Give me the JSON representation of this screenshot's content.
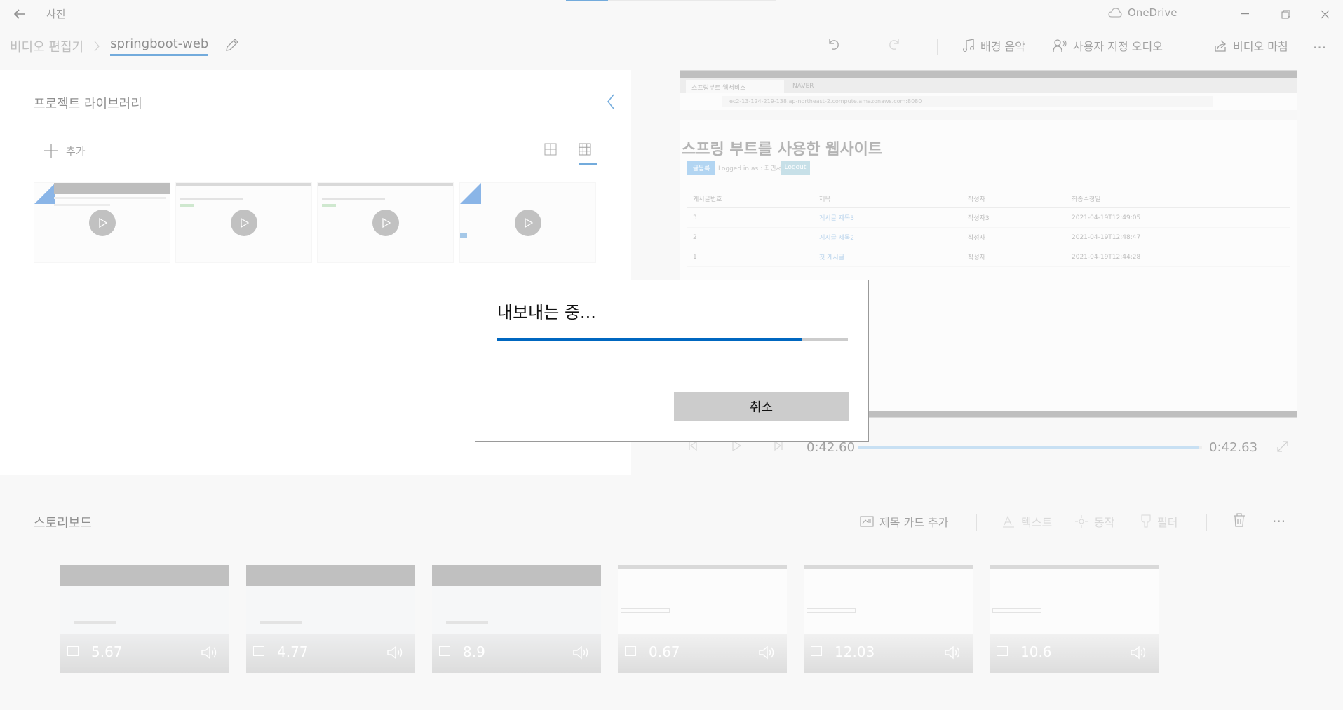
{
  "app": {
    "title": "사진",
    "cloud_label": "OneDrive"
  },
  "colors": {
    "accent": "#0067c0",
    "bg": "#f2f2f2"
  },
  "breadcrumb": {
    "parent": "비디오 편집기",
    "project": "springboot-web"
  },
  "toolbar": {
    "music_label": "배경 음악",
    "custom_audio_label": "사용자 지정 오디오",
    "finish_label": "비디오 마침"
  },
  "library": {
    "title": "프로젝트 라이브러리",
    "add_label": "추가"
  },
  "preview": {
    "site_title": "스프링 부트를 사용한 웹사이트",
    "tab1": "스프링부트 웹서비스",
    "tab2": "NAVER",
    "url": "ec2-13-124-219-138.ap-northeast-2.compute.amazonaws.com:8080",
    "btn_write": "글등록",
    "logged_in": "Logged in as : 최민서",
    "btn_logout": "Logout",
    "headers": [
      "게시글번호",
      "제목",
      "작성자",
      "최종수정일"
    ],
    "rows": [
      [
        "3",
        "게시글 제목3",
        "작성자3",
        "2021-04-19T12:49:05"
      ],
      [
        "2",
        "게시글 제목2",
        "작성자",
        "2021-04-19T12:48:47"
      ],
      [
        "1",
        "첫 게시글",
        "작성자",
        "2021-04-19T12:44:28"
      ]
    ]
  },
  "playback": {
    "current": "0:42.60",
    "total": "0:42.63",
    "progress": 0.99
  },
  "storyboard": {
    "title": "스토리보드",
    "add_title_card": "제목 카드 추가",
    "text": "텍스트",
    "motion": "동작",
    "filter": "필터",
    "clips": [
      {
        "duration": "5.67"
      },
      {
        "duration": "4.77"
      },
      {
        "duration": "8.9"
      },
      {
        "duration": "0.67"
      },
      {
        "duration": "12.03"
      },
      {
        "duration": "10.6"
      }
    ]
  },
  "export_dialog": {
    "title": "내보내는 중...",
    "progress": 0.87,
    "cancel_label": "취소"
  }
}
